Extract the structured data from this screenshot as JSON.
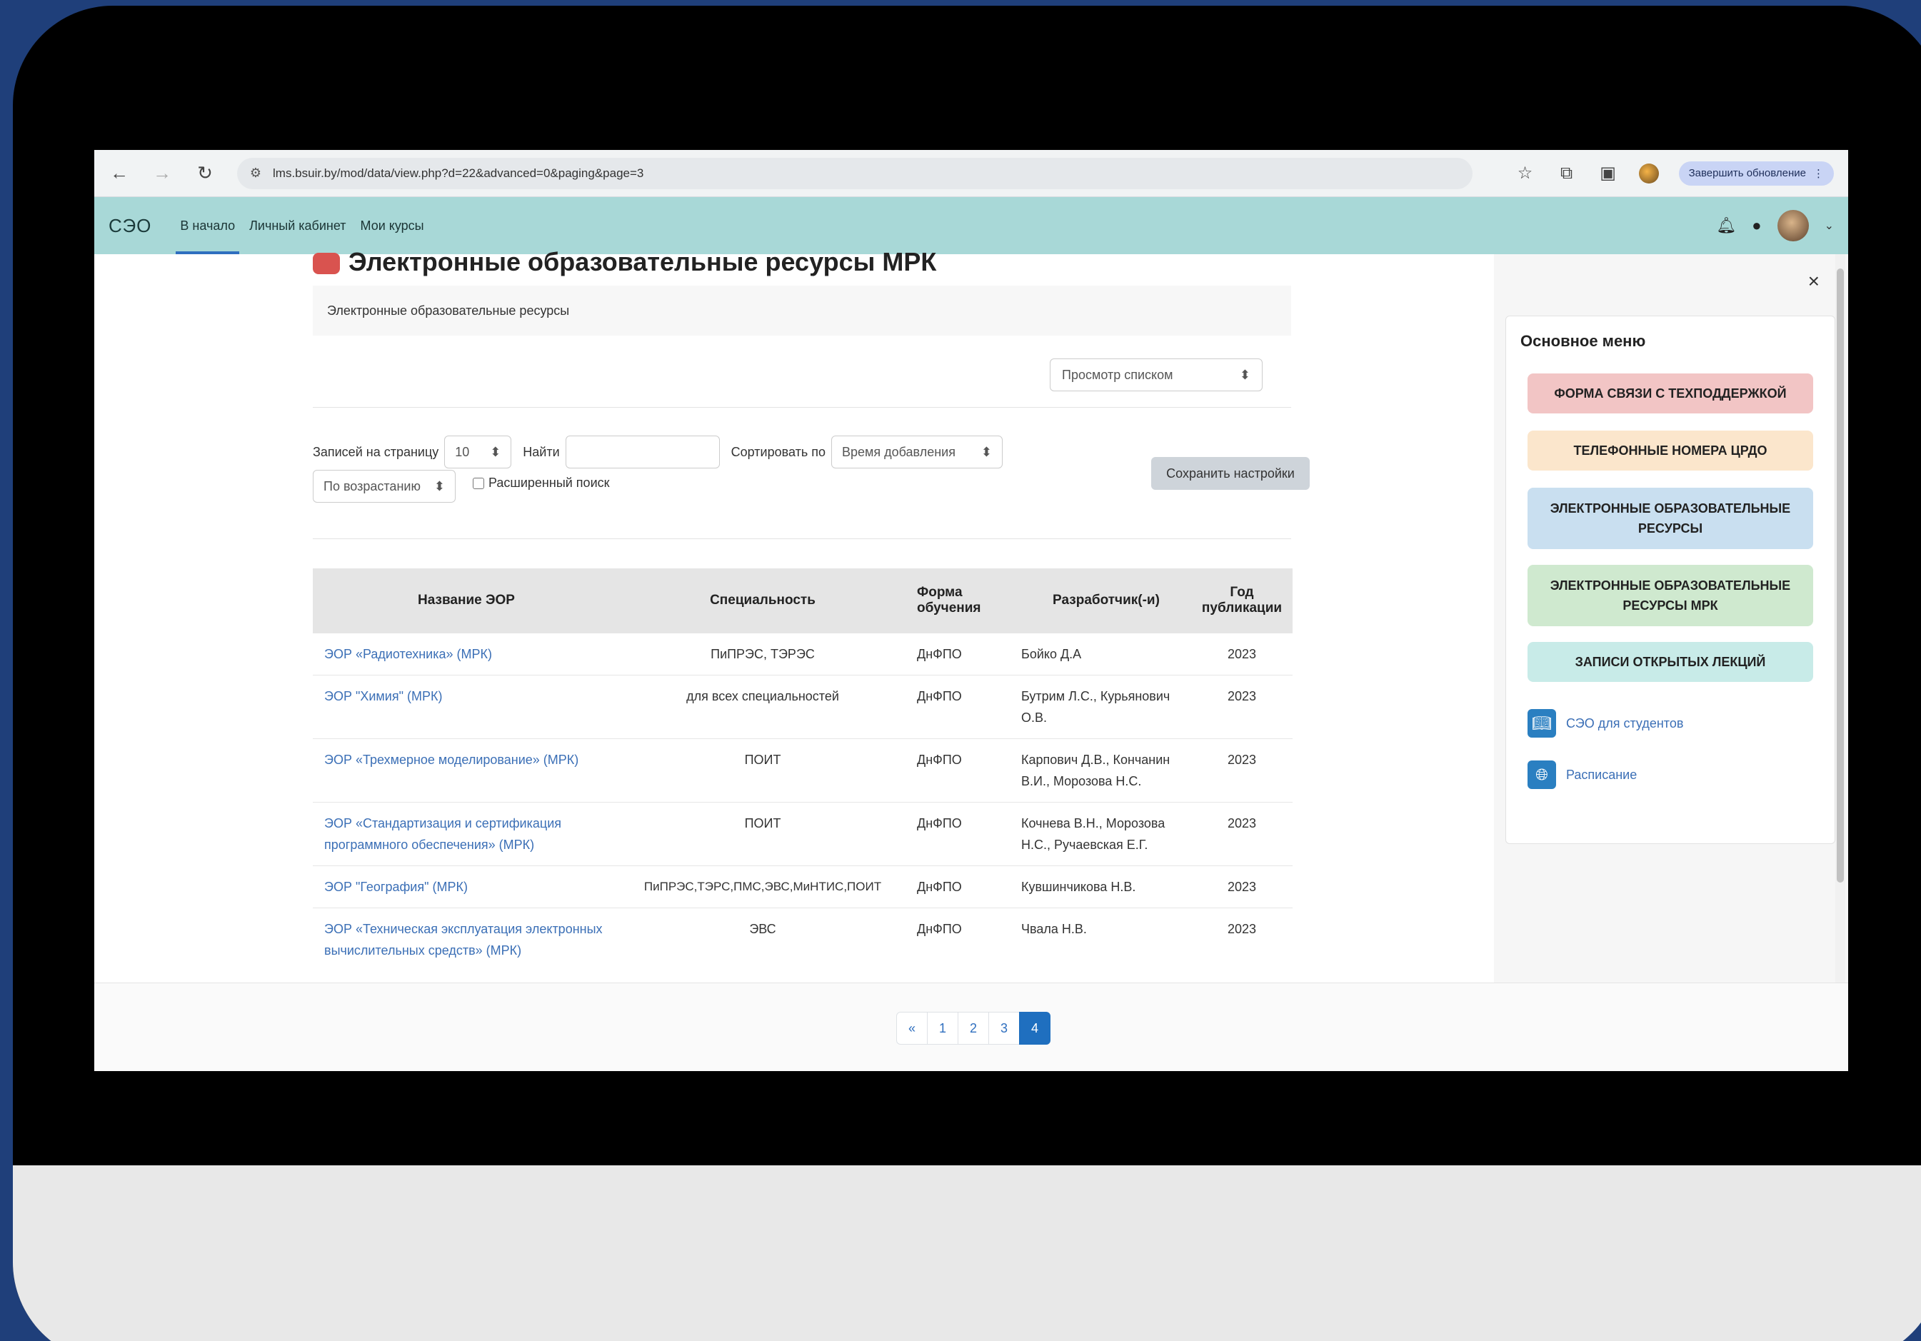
{
  "browser": {
    "url": "lms.bsuir.by/mod/data/view.php?d=22&advanced=0&paging&page=3",
    "update_label": "Завершить обновление"
  },
  "navbar": {
    "brand": "СЭО",
    "links": [
      "В начало",
      "Личный кабинет",
      "Мои курсы"
    ]
  },
  "page": {
    "title": "Электронные образовательные ресурсы МРК",
    "description": "Электронные образовательные ресурсы",
    "view_mode": "Просмотр списком"
  },
  "filters": {
    "per_page_label": "Записей на страницу",
    "per_page_value": "10",
    "search_label": "Найти",
    "sort_label": "Сортировать по",
    "sort_value": "Время добавления",
    "order_value": "По возрастанию",
    "advanced_label": "Расширенный поиск",
    "save_label": "Сохранить настройки"
  },
  "table": {
    "headers": [
      "Название ЭОР",
      "Специальность",
      "Форма обучения",
      "Разработчик(-и)",
      "Год публикации"
    ],
    "rows": [
      [
        "ЭОР «Радиотехника» (МРК)",
        "ПиПРЭС, ТЭРЭС",
        "ДнФПО",
        "Бойко Д.А",
        "2023"
      ],
      [
        "ЭОР \"Химия\" (МРК)",
        "для всех специальностей",
        "ДнФПО",
        "Бутрим Л.С., Курьянович О.В.",
        "2023"
      ],
      [
        "ЭОР «Трехмерное моделирование» (МРК)",
        "ПОИТ",
        "ДнФПО",
        "Карпович Д.В., Кончанин В.И., Морозова Н.С.",
        "2023"
      ],
      [
        "ЭОР «Стандартизация и сертификация программного обеспечения» (МРК)",
        "ПОИТ",
        "ДнФПО",
        "Кочнева В.Н., Морозова Н.С., Ручаевская Е.Г.",
        "2023"
      ],
      [
        "ЭОР \"География\" (МРК)",
        "ПиПРЭС,ТЭРС,ПМС,ЭВС,МиНТИС,ПОИТ",
        "ДнФПО",
        "Кувшинчикова Н.В.",
        "2023"
      ],
      [
        "ЭОР «Техническая эксплуатация электронных вычислительных средств» (МРК)",
        "ЭВС",
        "ДнФПО",
        "Чвала Н.В.",
        "2023"
      ]
    ]
  },
  "pagination": {
    "prev": "«",
    "pages": [
      "1",
      "2",
      "3",
      "4"
    ],
    "active": "4"
  },
  "drawer": {
    "close": "×",
    "title": "Основное меню",
    "buttons": [
      {
        "label": "ФОРМА СВЯЗИ С ТЕХПОДДЕРЖКОЙ",
        "color": "#f2c5c5"
      },
      {
        "label": "ТЕЛЕФОННЫЕ НОМЕРА ЦРДО",
        "color": "#fbe6cc"
      },
      {
        "label": "ЭЛЕКТРОННЫЕ ОБРАЗОВАТЕЛЬНЫЕ РЕСУРСЫ",
        "color": "#c9dff0"
      },
      {
        "label": "ЭЛЕКТРОННЫЕ ОБРАЗОВАТЕЛЬНЫЕ РЕСУРСЫ МРК",
        "color": "#cfe9cf"
      },
      {
        "label": "ЗАПИСИ ОТКРЫТЫХ ЛЕКЦИЙ",
        "color": "#c8ebe8"
      }
    ],
    "links": [
      "СЭО для студентов",
      "Расписание"
    ]
  }
}
